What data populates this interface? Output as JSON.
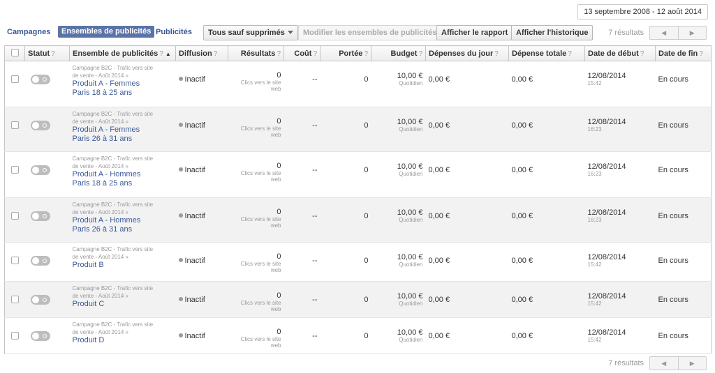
{
  "date_range": "13 septembre 2008 - 12 août 2014",
  "nav": {
    "campaigns": "Campagnes",
    "adsets": "Ensembles de publicités",
    "ads": "Publicités"
  },
  "toolbar": {
    "filter_label": "Tous sauf supprimés",
    "edit_label": "Modifier les ensembles de publicités",
    "report_label": "Afficher le rapport",
    "history_label": "Afficher l'historique",
    "results_count": "7 résultats"
  },
  "pager": {
    "prev": "◀",
    "next": "▶"
  },
  "table": {
    "columns": {
      "status": "Statut",
      "adset": "Ensemble de publicités",
      "sort_indicator": "▲",
      "delivery": "Diffusion",
      "results": "Résultats",
      "cost": "Coût",
      "reach": "Portée",
      "budget": "Budget",
      "daily_spend": "Dépenses du jour",
      "total_spend": "Dépense totale",
      "start_date": "Date de début",
      "end_date": "Date de fin"
    },
    "help_mark": "?",
    "rows": [
      {
        "campaign_line1": "Campagne B2C - Trafic vers site",
        "campaign_line2": "de vente - Août 2014 »",
        "name_line1": "Produit A - Femmes",
        "name_line2": "Paris 18 à 25 ans",
        "delivery": "Inactif",
        "results": "0",
        "results_label1": "Clics vers le site",
        "results_label2": "web",
        "cost": "--",
        "reach": "0",
        "budget": "10,00 €",
        "budget_type": "Quotidien",
        "daily_spend": "0,00 €",
        "total_spend": "0,00 €",
        "start_date": "12/08/2014",
        "start_time": "15:42",
        "end_date": "En cours"
      },
      {
        "campaign_line1": "Campagne B2C - Trafic vers site",
        "campaign_line2": "de vente - Août 2014 »",
        "name_line1": "Produit A - Femmes",
        "name_line2": "Paris 26 à 31 ans",
        "delivery": "Inactif",
        "results": "0",
        "results_label1": "Clics vers le site",
        "results_label2": "web",
        "cost": "--",
        "reach": "0",
        "budget": "10,00 €",
        "budget_type": "Quotidien",
        "daily_spend": "0,00 €",
        "total_spend": "0,00 €",
        "start_date": "12/08/2014",
        "start_time": "16:23",
        "end_date": "En cours"
      },
      {
        "campaign_line1": "Campagne B2C - Trafic vers site",
        "campaign_line2": "de vente - Août 2014 »",
        "name_line1": "Produit A - Hommes",
        "name_line2": "Paris 18 à 25 ans",
        "delivery": "Inactif",
        "results": "0",
        "results_label1": "Clics vers le site",
        "results_label2": "web",
        "cost": "--",
        "reach": "0",
        "budget": "10,00 €",
        "budget_type": "Quotidien",
        "daily_spend": "0,00 €",
        "total_spend": "0,00 €",
        "start_date": "12/08/2014",
        "start_time": "16:23",
        "end_date": "En cours"
      },
      {
        "campaign_line1": "Campagne B2C - Trafic vers site",
        "campaign_line2": "de vente - Août 2014 »",
        "name_line1": "Produit A - Hommes",
        "name_line2": "Paris 26 à 31 ans",
        "delivery": "Inactif",
        "results": "0",
        "results_label1": "Clics vers le site",
        "results_label2": "web",
        "cost": "--",
        "reach": "0",
        "budget": "10,00 €",
        "budget_type": "Quotidien",
        "daily_spend": "0,00 €",
        "total_spend": "0,00 €",
        "start_date": "12/08/2014",
        "start_time": "16:23",
        "end_date": "En cours"
      },
      {
        "campaign_line1": "Campagne B2C - Trafic vers site",
        "campaign_line2": "de vente - Août 2014 »",
        "name_line1": "Produit B",
        "name_line2": "",
        "delivery": "Inactif",
        "results": "0",
        "results_label1": "Clics vers le site",
        "results_label2": "web",
        "cost": "--",
        "reach": "0",
        "budget": "10,00 €",
        "budget_type": "Quotidien",
        "daily_spend": "0,00 €",
        "total_spend": "0,00 €",
        "start_date": "12/08/2014",
        "start_time": "15:42",
        "end_date": "En cours"
      },
      {
        "campaign_line1": "Campagne B2C - Trafic vers site",
        "campaign_line2": "de vente - Août 2014 »",
        "name_line1": "Produit C",
        "name_line2": "",
        "delivery": "Inactif",
        "results": "0",
        "results_label1": "Clics vers le site",
        "results_label2": "web",
        "cost": "--",
        "reach": "0",
        "budget": "10,00 €",
        "budget_type": "Quotidien",
        "daily_spend": "0,00 €",
        "total_spend": "0,00 €",
        "start_date": "12/08/2014",
        "start_time": "15:42",
        "end_date": "En cours"
      },
      {
        "campaign_line1": "Campagne B2C - Trafic vers site",
        "campaign_line2": "de vente - Août 2014 »",
        "name_line1": "Produit D",
        "name_line2": "",
        "delivery": "Inactif",
        "results": "0",
        "results_label1": "Clics vers le site",
        "results_label2": "web",
        "cost": "--",
        "reach": "0",
        "budget": "10,00 €",
        "budget_type": "Quotidien",
        "daily_spend": "0,00 €",
        "total_spend": "0,00 €",
        "start_date": "12/08/2014",
        "start_time": "15:42",
        "end_date": "En cours"
      }
    ]
  },
  "footer": {
    "results_count": "7 résultats"
  }
}
